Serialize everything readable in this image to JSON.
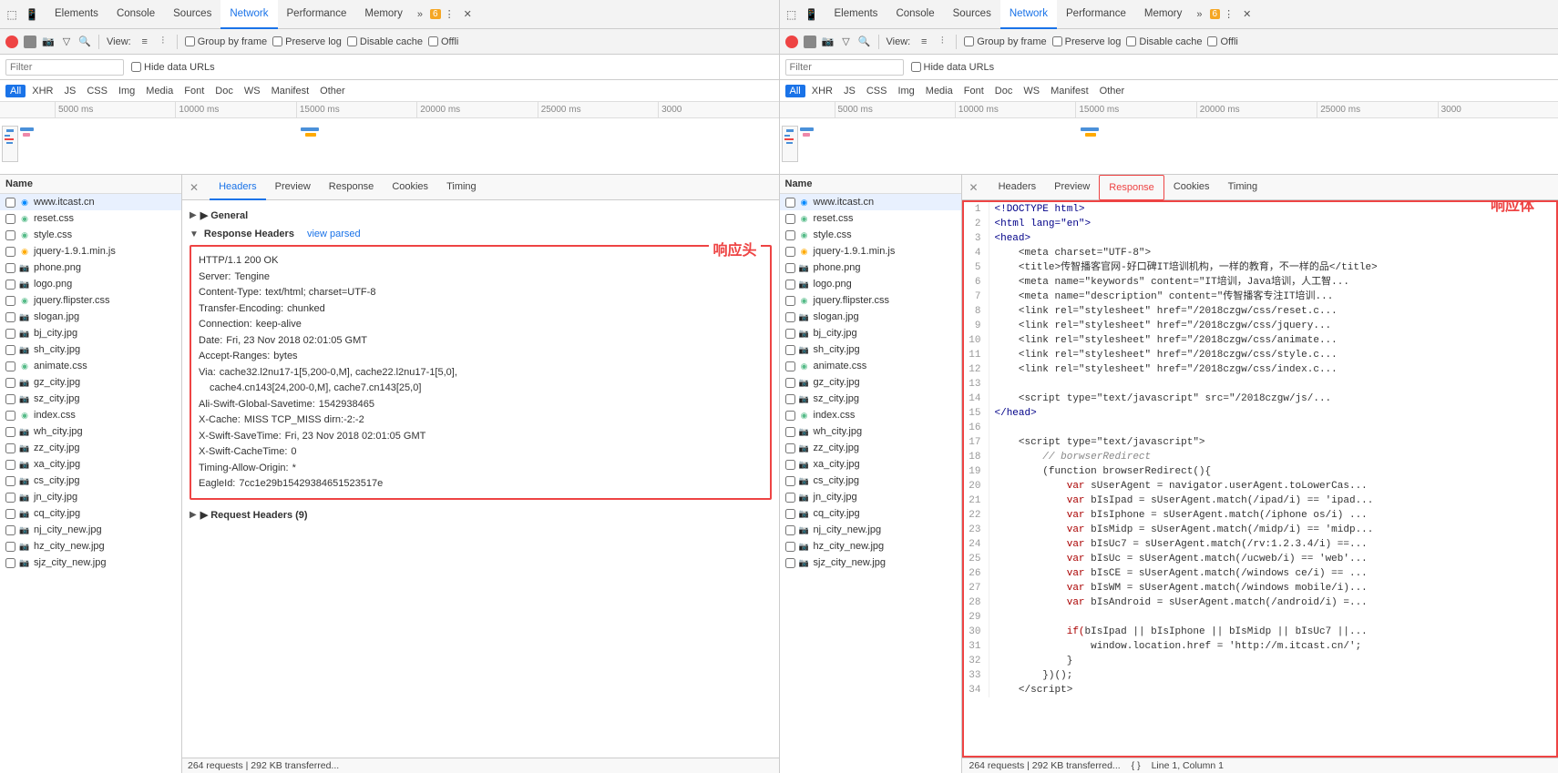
{
  "left_panel": {
    "tabs": [
      {
        "label": "Elements",
        "active": false
      },
      {
        "label": "Console",
        "active": false
      },
      {
        "label": "Sources",
        "active": false
      },
      {
        "label": "Network",
        "active": true
      },
      {
        "label": "Performance",
        "active": false
      },
      {
        "label": "Memory",
        "active": false
      }
    ],
    "warn_count": "6",
    "toolbar": {
      "view_label": "View:",
      "group_by_frame": "Group by frame",
      "preserve_log": "Preserve log",
      "disable_cache": "Disable cache",
      "offline": "Offli"
    },
    "filter_placeholder": "Filter",
    "hide_data_urls": "Hide data URLs",
    "type_filters": [
      "All",
      "XHR",
      "JS",
      "CSS",
      "Img",
      "Media",
      "Font",
      "Doc",
      "WS",
      "Manifest",
      "Other"
    ],
    "active_type": "All",
    "ruler_marks": [
      "5000 ms",
      "10000 ms",
      "15000 ms",
      "20000 ms",
      "25000 ms",
      "3000"
    ],
    "file_list_header": "Name",
    "files": [
      {
        "name": "www.itcast.cn",
        "type": "html",
        "selected": true
      },
      {
        "name": "reset.css",
        "type": "css"
      },
      {
        "name": "style.css",
        "type": "css"
      },
      {
        "name": "jquery-1.9.1.min.js",
        "type": "js"
      },
      {
        "name": "phone.png",
        "type": "img"
      },
      {
        "name": "logo.png",
        "type": "img"
      },
      {
        "name": "jquery.flipster.css",
        "type": "css"
      },
      {
        "name": "slogan.jpg",
        "type": "img"
      },
      {
        "name": "bj_city.jpg",
        "type": "img"
      },
      {
        "name": "sh_city.jpg",
        "type": "img"
      },
      {
        "name": "animate.css",
        "type": "css"
      },
      {
        "name": "gz_city.jpg",
        "type": "img"
      },
      {
        "name": "sz_city.jpg",
        "type": "img"
      },
      {
        "name": "index.css",
        "type": "css"
      },
      {
        "name": "wh_city.jpg",
        "type": "img"
      },
      {
        "name": "zz_city.jpg",
        "type": "img"
      },
      {
        "name": "xa_city.jpg",
        "type": "img"
      },
      {
        "name": "cs_city.jpg",
        "type": "img"
      },
      {
        "name": "jn_city.jpg",
        "type": "img"
      },
      {
        "name": "cq_city.jpg",
        "type": "img"
      },
      {
        "name": "nj_city_new.jpg",
        "type": "img"
      },
      {
        "name": "hz_city_new.jpg",
        "type": "img"
      },
      {
        "name": "sjz_city_new.jpg",
        "type": "img"
      }
    ],
    "status": "264 requests | 292 KB transferred...",
    "detail_tabs": [
      {
        "label": "Headers",
        "active": true
      },
      {
        "label": "Preview",
        "active": false
      },
      {
        "label": "Response",
        "active": false
      },
      {
        "label": "Cookies",
        "active": false
      },
      {
        "label": "Timing",
        "active": false
      }
    ],
    "general_section": "▶ General",
    "response_headers_title": "Response Headers",
    "view_parsed": "view parsed",
    "annotation": "响应头",
    "response_headers": [
      {
        "name": "HTTP/1.1 200 OK",
        "value": ""
      },
      {
        "name": "Server:",
        "value": "Tengine"
      },
      {
        "name": "Content-Type:",
        "value": "text/html; charset=UTF-8"
      },
      {
        "name": "Transfer-Encoding:",
        "value": "chunked"
      },
      {
        "name": "Connection:",
        "value": "keep-alive"
      },
      {
        "name": "Date:",
        "value": "Fri, 23 Nov 2018 02:01:05 GMT"
      },
      {
        "name": "Accept-Ranges:",
        "value": "bytes"
      },
      {
        "name": "Via:",
        "value": "cache32.l2nu17-1[5,200-0,M], cache22.l2nu17-1[5,0],"
      },
      {
        "name": "",
        "value": "cache4.cn143[24,200-0,M], cache7.cn143[25,0]"
      },
      {
        "name": "Ali-Swift-Global-Savetime:",
        "value": "1542938465"
      },
      {
        "name": "X-Cache:",
        "value": "MISS TCP_MISS dirn:-2:-2"
      },
      {
        "name": "X-Swift-SaveTime:",
        "value": "Fri, 23 Nov 2018 02:01:05 GMT"
      },
      {
        "name": "X-Swift-CacheTime:",
        "value": "0"
      },
      {
        "name": "Timing-Allow-Origin:",
        "value": "*"
      },
      {
        "name": "EagleId:",
        "value": "7cc1e29b15429384651523517e"
      }
    ],
    "request_headers_collapsed": "▶ Request Headers (9)"
  },
  "right_panel": {
    "tabs": [
      {
        "label": "Elements",
        "active": false
      },
      {
        "label": "Console",
        "active": false
      },
      {
        "label": "Sources",
        "active": false
      },
      {
        "label": "Network",
        "active": true
      },
      {
        "label": "Performance",
        "active": false
      },
      {
        "label": "Memory",
        "active": false
      }
    ],
    "warn_count": "6",
    "toolbar": {
      "view_label": "View:",
      "group_by_frame": "Group by frame",
      "preserve_log": "Preserve log",
      "disable_cache": "Disable cache",
      "offline": "Offli"
    },
    "filter_placeholder": "Filter",
    "hide_data_urls": "Hide data URLs",
    "type_filters": [
      "All",
      "XHR",
      "JS",
      "CSS",
      "Img",
      "Media",
      "Font",
      "Doc",
      "WS",
      "Manifest",
      "Other"
    ],
    "active_type": "All",
    "ruler_marks": [
      "5000 ms",
      "10000 ms",
      "15000 ms",
      "20000 ms",
      "25000 ms",
      "3000"
    ],
    "file_list_header": "Name",
    "files": [
      {
        "name": "www.itcast.cn",
        "type": "html",
        "selected": true
      },
      {
        "name": "reset.css",
        "type": "css"
      },
      {
        "name": "style.css",
        "type": "css"
      },
      {
        "name": "jquery-1.9.1.min.js",
        "type": "js"
      },
      {
        "name": "phone.png",
        "type": "img"
      },
      {
        "name": "logo.png",
        "type": "img"
      },
      {
        "name": "jquery.flipster.css",
        "type": "css"
      },
      {
        "name": "slogan.jpg",
        "type": "img"
      },
      {
        "name": "bj_city.jpg",
        "type": "img"
      },
      {
        "name": "sh_city.jpg",
        "type": "img"
      },
      {
        "name": "animate.css",
        "type": "css"
      },
      {
        "name": "gz_city.jpg",
        "type": "img"
      },
      {
        "name": "sz_city.jpg",
        "type": "img"
      },
      {
        "name": "index.css",
        "type": "css"
      },
      {
        "name": "wh_city.jpg",
        "type": "img"
      },
      {
        "name": "zz_city.jpg",
        "type": "img"
      },
      {
        "name": "xa_city.jpg",
        "type": "img"
      },
      {
        "name": "cs_city.jpg",
        "type": "img"
      },
      {
        "name": "jn_city.jpg",
        "type": "img"
      },
      {
        "name": "cq_city.jpg",
        "type": "img"
      },
      {
        "name": "nj_city_new.jpg",
        "type": "img"
      },
      {
        "name": "hz_city_new.jpg",
        "type": "img"
      },
      {
        "name": "sjz_city_new.jpg",
        "type": "img"
      }
    ],
    "status": "264 requests | 292 KB transferred...",
    "detail_tabs": [
      {
        "label": "Headers",
        "active": false
      },
      {
        "label": "Preview",
        "active": false
      },
      {
        "label": "Response",
        "active": true
      },
      {
        "label": "Cookies",
        "active": false
      },
      {
        "label": "Timing",
        "active": false
      }
    ],
    "annotation": "响应体",
    "code_lines": [
      {
        "num": 1,
        "html": "&lt;!DOCTYPE html&gt;"
      },
      {
        "num": 2,
        "html": "&lt;html lang=\"en\"&gt;"
      },
      {
        "num": 3,
        "html": "&lt;head&gt;"
      },
      {
        "num": 4,
        "html": "    &lt;meta charset=\"UTF-8\"&gt;"
      },
      {
        "num": 5,
        "html": "    &lt;title&gt;传智播客官网-好口碑IT培训机构，一样的教育，不一样的品&lt;/title&gt;"
      },
      {
        "num": 6,
        "html": "    &lt;meta name=\"keywords\" content=\"IT培训，Java培训，人工智..."
      },
      {
        "num": 7,
        "html": "    &lt;meta name=\"description\" content=\"传智播客专注IT培训..."
      },
      {
        "num": 8,
        "html": "    &lt;link rel=\"stylesheet\" href=\"/2018czgw/css/reset.c..."
      },
      {
        "num": 9,
        "html": "    &lt;link rel=\"stylesheet\" href=\"/2018czgw/css/jquery..."
      },
      {
        "num": 10,
        "html": "    &lt;link rel=\"stylesheet\" href=\"/2018czgw/css/animate..."
      },
      {
        "num": 11,
        "html": "    &lt;link rel=\"stylesheet\" href=\"/2018czgw/css/style.c..."
      },
      {
        "num": 12,
        "html": "    &lt;link rel=\"stylesheet\" href=\"/2018czgw/css/index.c..."
      },
      {
        "num": 13,
        "html": ""
      },
      {
        "num": 14,
        "html": "    &lt;script type=\"text/javascript\" src=\"/2018czgw/js/..."
      },
      {
        "num": 15,
        "html": "&lt;/head&gt;"
      },
      {
        "num": 16,
        "html": ""
      },
      {
        "num": 17,
        "html": "    &lt;script type=\"text/javascript\"&gt;"
      },
      {
        "num": 18,
        "html": "        // borwserRedirect"
      },
      {
        "num": 19,
        "html": "        (function browserRedirect(){"
      },
      {
        "num": 20,
        "html": "            var sUserAgent = navigator.userAgent.toLowerCas..."
      },
      {
        "num": 21,
        "html": "            var bIsIpad = sUserAgent.match(/ipad/i) == 'ipad..."
      },
      {
        "num": 22,
        "html": "            var bIsIphone = sUserAgent.match(/iphone os/i) ..."
      },
      {
        "num": 23,
        "html": "            var bIsMidp = sUserAgent.match(/midp/i) == 'midp..."
      },
      {
        "num": 24,
        "html": "            var bIsUc7 = sUserAgent.match(/rv:1.2.3.4/i) ==..."
      },
      {
        "num": 25,
        "html": "            var bIsUc = sUserAgent.match(/ucweb/i) == 'web'..."
      },
      {
        "num": 26,
        "html": "            var bIsCE = sUserAgent.match(/windows ce/i) == ..."
      },
      {
        "num": 27,
        "html": "            var bIsWM = sUserAgent.match(/windows mobile/i)..."
      },
      {
        "num": 28,
        "html": "            var bIsAndroid = sUserAgent.match(/android/i) =..."
      },
      {
        "num": 29,
        "html": ""
      },
      {
        "num": 30,
        "html": "            if(bIsIpad || bIsIphone || bIsMidp || bIsUc7 ||..."
      },
      {
        "num": 31,
        "html": "                window.location.href = 'http://m.itcast.cn/';"
      },
      {
        "num": 32,
        "html": "            }"
      },
      {
        "num": 33,
        "html": "        })();"
      },
      {
        "num": 34,
        "html": "    &lt;/script&gt;"
      }
    ],
    "bottom_bar": {
      "left": "{ }",
      "right": "Line 1, Column 1"
    }
  }
}
